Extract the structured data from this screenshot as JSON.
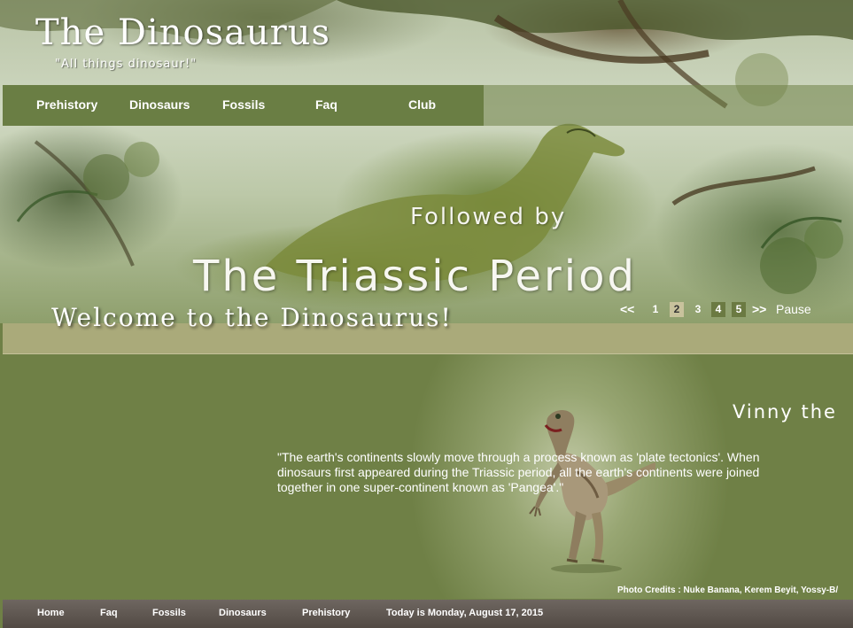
{
  "header": {
    "site_title": "The Dinosaurus",
    "tagline": "\"All things dinosaur!\""
  },
  "nav": {
    "items": [
      {
        "label": "Prehistory"
      },
      {
        "label": "Dinosaurs"
      },
      {
        "label": "Fossils"
      },
      {
        "label": "Faq"
      },
      {
        "label": "Club"
      }
    ]
  },
  "slideshow": {
    "subtitle": "Followed by",
    "title": "The Triassic Period",
    "pager": {
      "prev": "<<",
      "pages": [
        "1",
        "2",
        "3",
        "4",
        "5"
      ],
      "active_page": "2",
      "next": ">>",
      "pause": "Pause"
    }
  },
  "welcome": "Welcome to the Dinosaurus!",
  "main": {
    "feature_title": "Vinny the",
    "quote": "\"The earth's continents slowly move through a process known as 'plate tectonics'. When dinosaurs first appeared during the Triassic period, all the earth's continents were joined together in one super-continent known as 'Pangea'.\"",
    "credits": "Photo Credits : Nuke Banana, Kerem Beyit, Yossy-B/"
  },
  "footer": {
    "links": [
      {
        "label": "Home"
      },
      {
        "label": "Faq"
      },
      {
        "label": "Fossils"
      },
      {
        "label": "Dinosaurs"
      },
      {
        "label": "Prehistory"
      }
    ],
    "date": "Today is Monday, August 17, 2015"
  },
  "colors": {
    "nav_bg": "#62763a",
    "main_bg": "#6f8046",
    "band": "#aaaa7a",
    "footer": "#5e5650",
    "active_page": "#c8c29c"
  }
}
